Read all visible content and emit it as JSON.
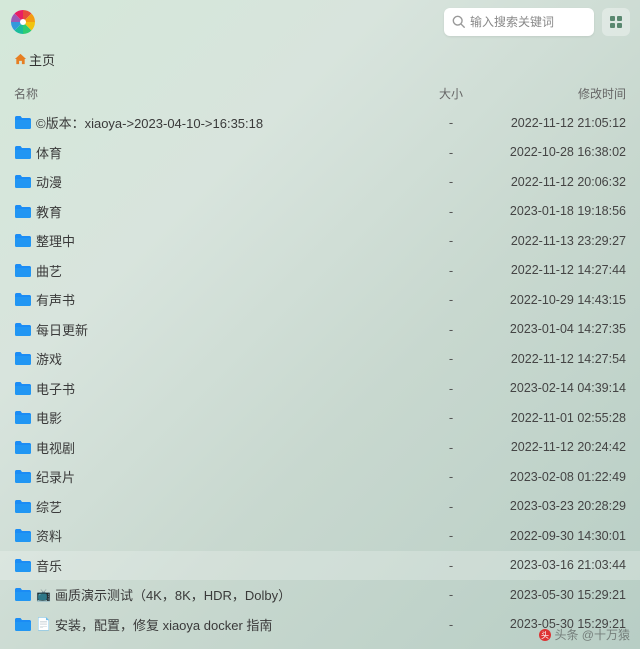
{
  "search": {
    "placeholder": "输入搜索关键词"
  },
  "breadcrumb": {
    "home": "主页"
  },
  "columns": {
    "name": "名称",
    "size": "大小",
    "time": "修改时间"
  },
  "rows": [
    {
      "icon": "folder",
      "emoji": "",
      "name": "©版本：xiaoya->2023-04-10->16:35:18",
      "size": "-",
      "time": "2022-11-12 21:05:12",
      "sel": false
    },
    {
      "icon": "folder",
      "emoji": "",
      "name": "体育",
      "size": "-",
      "time": "2022-10-28 16:38:02",
      "sel": false
    },
    {
      "icon": "folder",
      "emoji": "",
      "name": "动漫",
      "size": "-",
      "time": "2022-11-12 20:06:32",
      "sel": false
    },
    {
      "icon": "folder",
      "emoji": "",
      "name": "教育",
      "size": "-",
      "time": "2023-01-18 19:18:56",
      "sel": false
    },
    {
      "icon": "folder",
      "emoji": "",
      "name": "整理中",
      "size": "-",
      "time": "2022-11-13 23:29:27",
      "sel": false
    },
    {
      "icon": "folder",
      "emoji": "",
      "name": "曲艺",
      "size": "-",
      "time": "2022-11-12 14:27:44",
      "sel": false
    },
    {
      "icon": "folder",
      "emoji": "",
      "name": "有声书",
      "size": "-",
      "time": "2022-10-29 14:43:15",
      "sel": false
    },
    {
      "icon": "folder",
      "emoji": "",
      "name": "每日更新",
      "size": "-",
      "time": "2023-01-04 14:27:35",
      "sel": false
    },
    {
      "icon": "folder",
      "emoji": "",
      "name": "游戏",
      "size": "-",
      "time": "2022-11-12 14:27:54",
      "sel": false
    },
    {
      "icon": "folder",
      "emoji": "",
      "name": "电子书",
      "size": "-",
      "time": "2023-02-14 04:39:14",
      "sel": false
    },
    {
      "icon": "folder",
      "emoji": "",
      "name": "电影",
      "size": "-",
      "time": "2022-11-01 02:55:28",
      "sel": false
    },
    {
      "icon": "folder",
      "emoji": "",
      "name": "电视剧",
      "size": "-",
      "time": "2022-11-12 20:24:42",
      "sel": false
    },
    {
      "icon": "folder",
      "emoji": "",
      "name": "纪录片",
      "size": "-",
      "time": "2023-02-08 01:22:49",
      "sel": false
    },
    {
      "icon": "folder",
      "emoji": "",
      "name": "综艺",
      "size": "-",
      "time": "2023-03-23 20:28:29",
      "sel": false
    },
    {
      "icon": "folder",
      "emoji": "",
      "name": "资料",
      "size": "-",
      "time": "2022-09-30 14:30:01",
      "sel": false
    },
    {
      "icon": "folder",
      "emoji": "",
      "name": "音乐",
      "size": "-",
      "time": "2023-03-16 21:03:44",
      "sel": true
    },
    {
      "icon": "folder",
      "emoji": "📺",
      "name": "画质演示测试（4K，8K，HDR，Dolby）",
      "size": "-",
      "time": "2023-05-30 15:29:21",
      "sel": false
    },
    {
      "icon": "folder",
      "emoji": "📄",
      "name": "安装，配置，修复 xiaoya docker 指南",
      "size": "-",
      "time": "2023-05-30 15:29:21",
      "sel": false
    }
  ],
  "watermark": {
    "text": "头条 @十万猿"
  }
}
